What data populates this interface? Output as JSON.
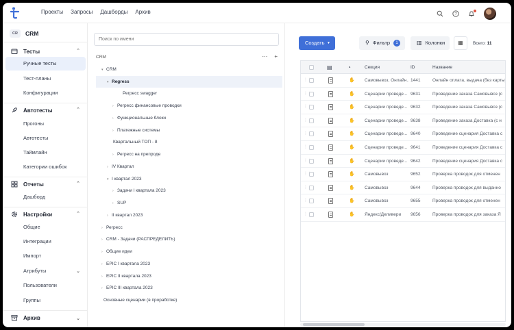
{
  "topnav": {
    "items": [
      "Проекты",
      "Запросы",
      "Дашборды",
      "Архив"
    ]
  },
  "colors": {
    "accent": "#3f6fd8",
    "active_bg": "#eaf0fb",
    "notification": "#e0523f"
  },
  "project": {
    "badge": "CR",
    "name": "CRM"
  },
  "sidebar": {
    "sections": [
      {
        "label": "Тесты",
        "icon": "folder-icon",
        "items": [
          "Ручные тесты",
          "Тест-планы",
          "Конфигурации"
        ],
        "active": "Ручные тесты"
      },
      {
        "label": "Автотесты",
        "icon": "rocket-icon",
        "items": [
          "Прогоны",
          "Автотесты",
          "Таймлайн",
          "Категории ошибок"
        ]
      },
      {
        "label": "Отчеты",
        "icon": "grid-icon",
        "items": [
          "Дашборд"
        ]
      },
      {
        "label": "Настройки",
        "icon": "gear-icon",
        "items": [
          "Общие",
          "Интеграции",
          "Импорт",
          "Атрибуты",
          "Пользователи",
          "Группы"
        ]
      },
      {
        "label": "Архив",
        "icon": "archive-icon",
        "items": []
      }
    ]
  },
  "tree": {
    "search_placeholder": "Поиск по имени",
    "root_label": "CRM",
    "nodes": [
      {
        "label": "CRM",
        "arrow": "▾"
      },
      {
        "label": "Regress",
        "arrow": "▾",
        "selected": true
      },
      {
        "label": "Регресс swagger",
        "arrow": ""
      },
      {
        "label": "Регресс финансовые проводки",
        "arrow": "›"
      },
      {
        "label": "Функциональные блоки",
        "arrow": "›"
      },
      {
        "label": "Платежные системы",
        "arrow": "›"
      },
      {
        "label": "Квартальный ТОП - 8",
        "arrow": ""
      },
      {
        "label": "Регресс на препроде",
        "arrow": "›"
      },
      {
        "label": "IV Квартал",
        "arrow": "›"
      },
      {
        "label": "I квартал 2023",
        "arrow": "▾"
      },
      {
        "label": "Задачи I квартала 2023",
        "arrow": "›"
      },
      {
        "label": "SUP",
        "arrow": "›"
      },
      {
        "label": "II квартал 2023",
        "arrow": "›"
      },
      {
        "label": "Регресс",
        "arrow": "›"
      },
      {
        "label": "CRM - Задачи (РАСПРЕДЕЛИТЬ)",
        "arrow": "›"
      },
      {
        "label": "Общие идеи",
        "arrow": "›"
      },
      {
        "label": "EPIC I квартала 2023",
        "arrow": "›"
      },
      {
        "label": "EPIC II квартала 2023",
        "arrow": "›"
      },
      {
        "label": "EPIC III квартала 2023",
        "arrow": "›"
      },
      {
        "label": "Основные сценарии (в проработке)",
        "arrow": ""
      }
    ]
  },
  "toolbar": {
    "create_label": "Создать",
    "filter_label": "Фильтр",
    "filter_count": "1",
    "columns_label": "Колонки",
    "total_label": "Всего:",
    "total_value": "11"
  },
  "table": {
    "columns": [
      "Секция",
      "ID",
      "Название"
    ],
    "rows": [
      {
        "section": "Самовывоз, Онлайн...",
        "id": "1441",
        "name": "Онлайн оплата, выдача (без карты)"
      },
      {
        "section": "Сценарии проведе...",
        "id": "9631",
        "name": "Проведение заказа Самовывоз (с"
      },
      {
        "section": "Сценарии проведе...",
        "id": "9632",
        "name": "Проведение заказа Самовывоз (с"
      },
      {
        "section": "Сценарии проведе...",
        "id": "9638",
        "name": "Проведение заказа Доставка (с н"
      },
      {
        "section": "Сценарии проведе...",
        "id": "9640",
        "name": "Проведение сценария Доставка с"
      },
      {
        "section": "Сценарии проведе...",
        "id": "9641",
        "name": "Проведение сценария Доставка с"
      },
      {
        "section": "Сценарии проведе...",
        "id": "9642",
        "name": "Проведение сценария Доставка с"
      },
      {
        "section": "Самовывоз",
        "id": "9652",
        "name": "Проверка проводок для отменен"
      },
      {
        "section": "Самовывоз",
        "id": "9644",
        "name": "Проверка проводок для выданно"
      },
      {
        "section": "Самовывоз",
        "id": "9655",
        "name": "Проверка проводок для отменен"
      },
      {
        "section": "Яндекс/Деливери",
        "id": "9656",
        "name": "Проверка проводок для заказа Я"
      }
    ]
  }
}
